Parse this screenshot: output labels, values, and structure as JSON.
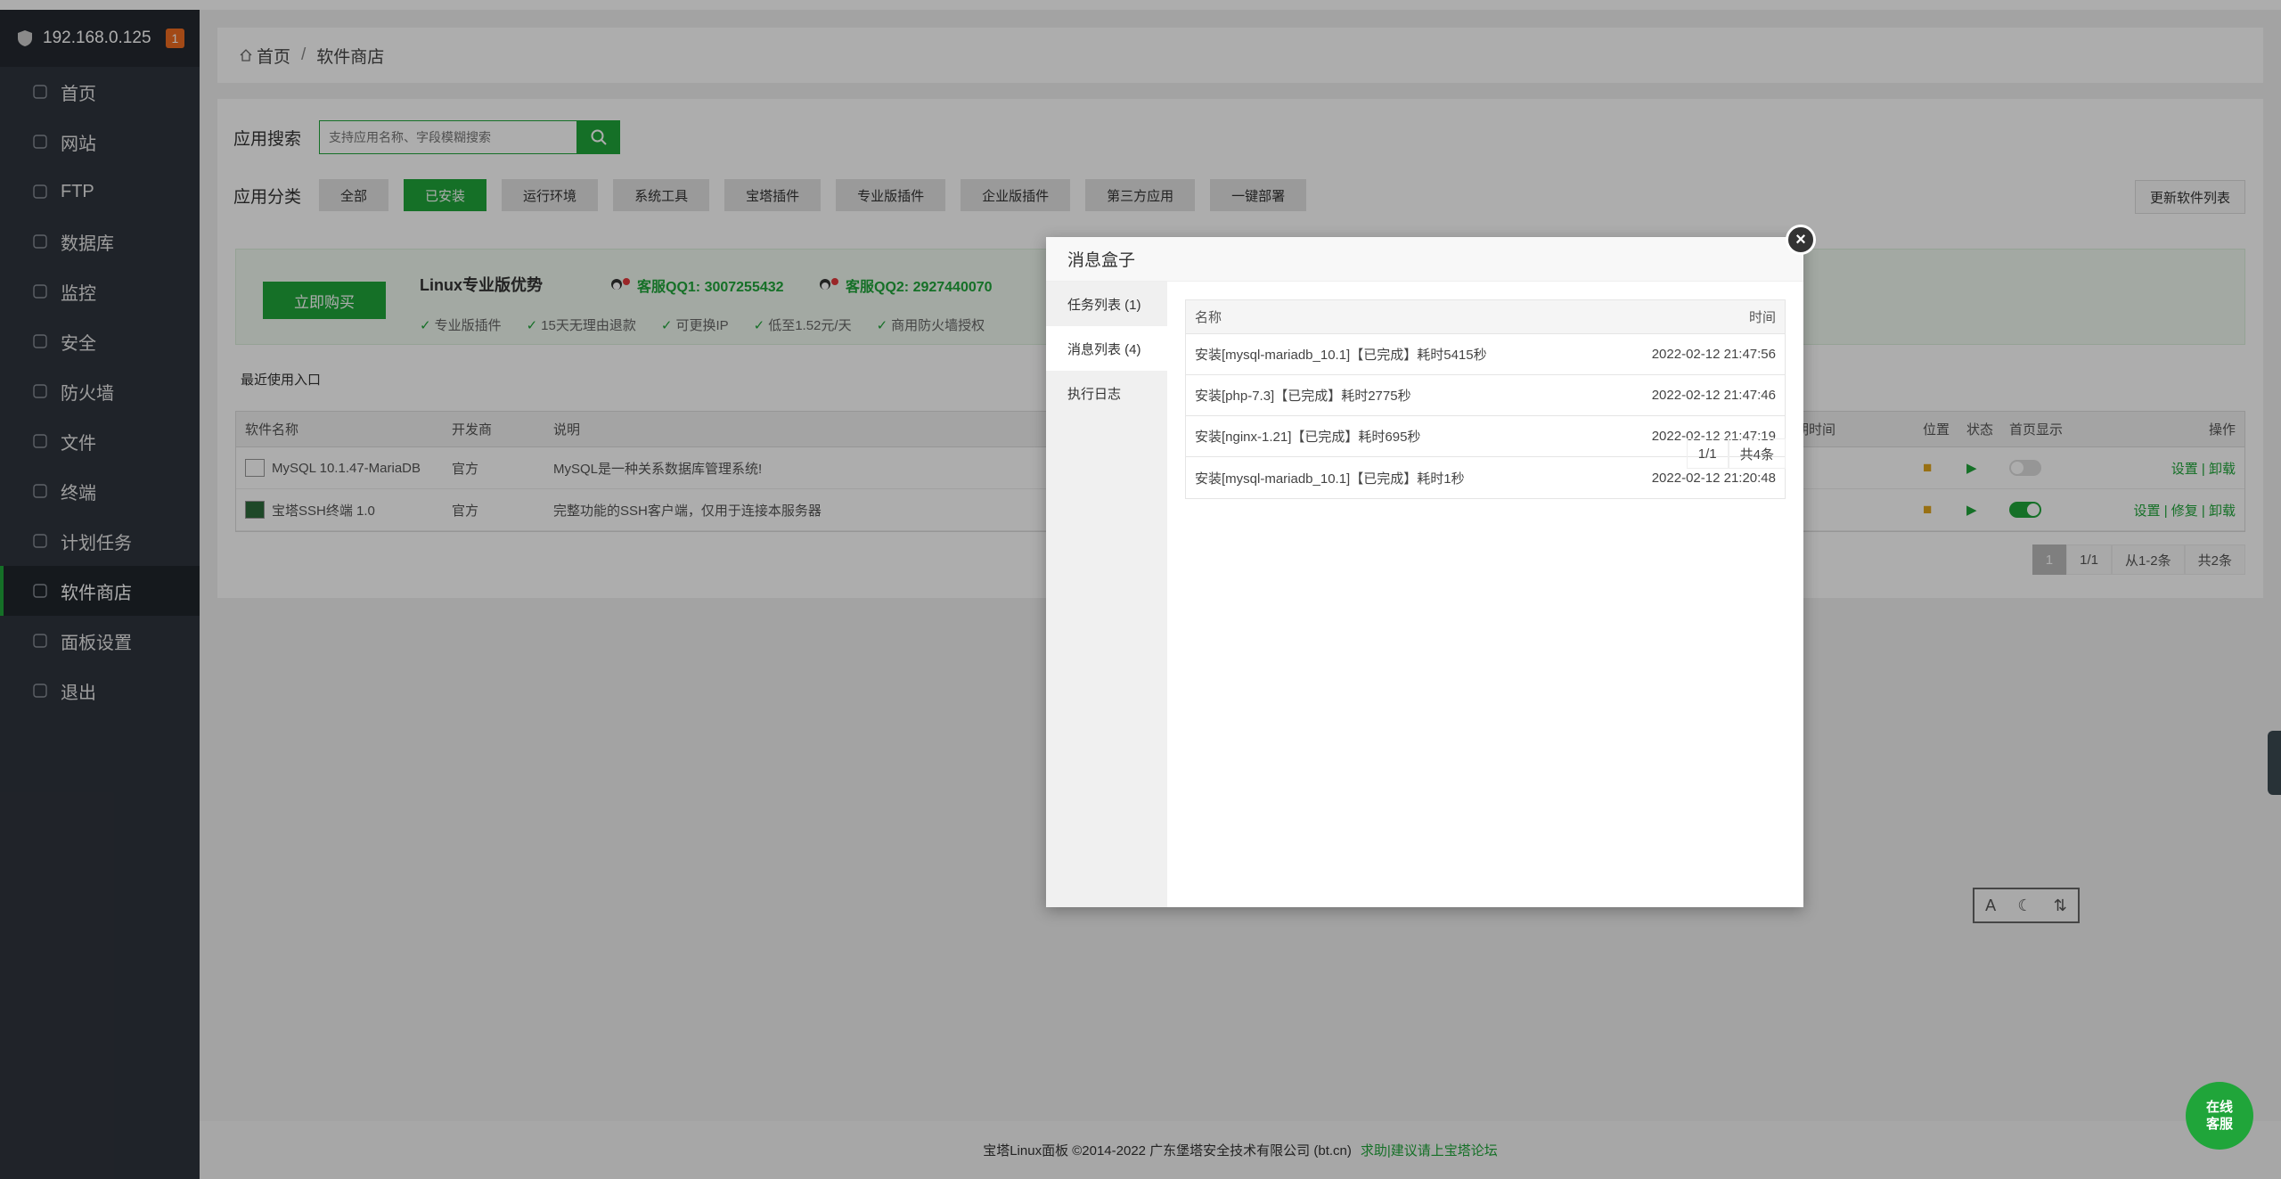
{
  "sidebar": {
    "host": "192.168.0.125",
    "badge": "1",
    "items": [
      {
        "label": "首页",
        "icon": "home-icon"
      },
      {
        "label": "网站",
        "icon": "globe-icon"
      },
      {
        "label": "FTP",
        "icon": "ftp-icon"
      },
      {
        "label": "数据库",
        "icon": "database-icon"
      },
      {
        "label": "监控",
        "icon": "monitor-icon"
      },
      {
        "label": "安全",
        "icon": "shield-icon"
      },
      {
        "label": "防火墙",
        "icon": "firewall-icon"
      },
      {
        "label": "文件",
        "icon": "folder-icon"
      },
      {
        "label": "终端",
        "icon": "terminal-icon"
      },
      {
        "label": "计划任务",
        "icon": "calendar-icon"
      },
      {
        "label": "软件商店",
        "icon": "grid-icon"
      },
      {
        "label": "面板设置",
        "icon": "gear-icon"
      },
      {
        "label": "退出",
        "icon": "logout-icon"
      }
    ]
  },
  "breadcrumb": {
    "home": "首页",
    "sep": "/",
    "current": "软件商店"
  },
  "search": {
    "label": "应用搜索",
    "placeholder": "支持应用名称、字段模糊搜索"
  },
  "categories": {
    "label": "应用分类",
    "items": [
      "全部",
      "已安装",
      "运行环境",
      "系统工具",
      "宝塔插件",
      "专业版插件",
      "企业版插件",
      "第三方应用",
      "一键部署"
    ],
    "active": "已安装",
    "update_button": "更新软件列表"
  },
  "promo": {
    "buy": "立即购买",
    "title": "Linux专业版优势",
    "qq1": "客服QQ1: 3007255432",
    "qq2": "客服QQ2: 2927440070",
    "features": [
      "专业版插件",
      "15天无理由退款",
      "可更换IP",
      "低至1.52元/天",
      "商用防火墙授权"
    ]
  },
  "recent_label": "最近使用入口",
  "table": {
    "headers": {
      "name": "软件名称",
      "dev": "开发商",
      "desc": "说明",
      "expire": "期时间",
      "loc": "位置",
      "status": "状态",
      "home": "首页显示",
      "op": "操作"
    },
    "rows": [
      {
        "name": "MySQL 10.1.47-MariaDB",
        "dev": "官方",
        "desc": "MySQL是一种关系数据库管理系统!",
        "home_on": false,
        "op": "设置 | 卸载"
      },
      {
        "name": "宝塔SSH终端 1.0",
        "dev": "官方",
        "desc": "完整功能的SSH客户端，仅用于连接本服务器",
        "home_on": true,
        "op": "设置 | 修复 | 卸载"
      }
    ]
  },
  "pager": {
    "current": "1",
    "pages": "1/1",
    "range": "从1-2条",
    "total": "共2条"
  },
  "footer": {
    "copyright": "宝塔Linux面板 ©2014-2022 广东堡塔安全技术有限公司 (bt.cn)",
    "link": "求助|建议请上宝塔论坛"
  },
  "modal": {
    "title": "消息盒子",
    "close": "×",
    "tabs": [
      "任务列表 (1)",
      "消息列表 (4)",
      "执行日志"
    ],
    "active_tab": "消息列表 (4)",
    "headers": {
      "name": "名称",
      "time": "时间"
    },
    "rows": [
      {
        "name": "安装[mysql-mariadb_10.1]【已完成】耗时5415秒",
        "time": "2022-02-12 21:47:56"
      },
      {
        "name": "安装[php-7.3]【已完成】耗时2775秒",
        "time": "2022-02-12 21:47:46"
      },
      {
        "name": "安装[nginx-1.21]【已完成】耗时695秒",
        "time": "2022-02-12 21:47:19"
      },
      {
        "name": "安装[mysql-mariadb_10.1]【已完成】耗时1秒",
        "time": "2022-02-12 21:20:48"
      }
    ],
    "pager": {
      "pages": "1/1",
      "total": "共4条"
    }
  },
  "online_service": "在线\n客服",
  "colors": {
    "accent": "#20a53a",
    "sidebar": "#2f343d",
    "badge": "#ef6c21"
  }
}
